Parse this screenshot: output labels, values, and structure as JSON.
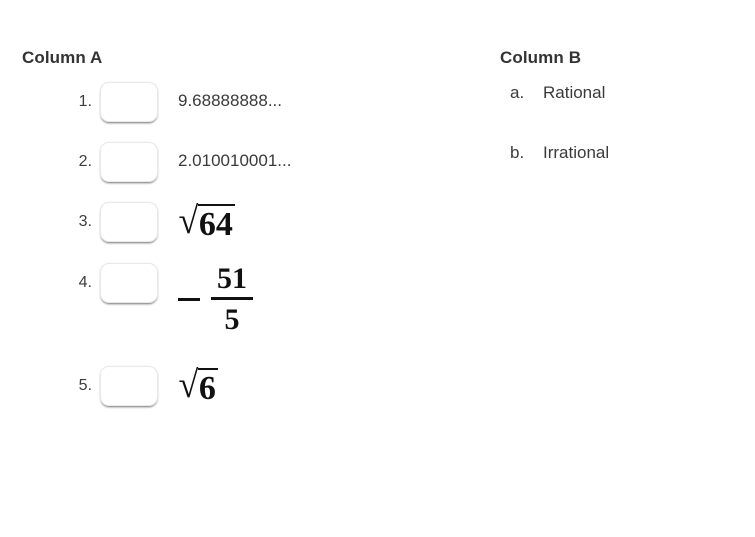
{
  "columns": {
    "a": {
      "heading": "Column A",
      "items": [
        {
          "number": "1.",
          "kind": "decimal",
          "text": "9.68888888..."
        },
        {
          "number": "2.",
          "kind": "decimal",
          "text": "2.010010001..."
        },
        {
          "number": "3.",
          "kind": "radical",
          "radical_sign": "√",
          "radicand": "64"
        },
        {
          "number": "4.",
          "kind": "neg-fraction",
          "sign": "−",
          "numerator": "51",
          "denominator": "5"
        },
        {
          "number": "5.",
          "kind": "radical",
          "radical_sign": "√",
          "radicand": "6"
        }
      ]
    },
    "b": {
      "heading": "Column B",
      "items": [
        {
          "letter": "a.",
          "label": "Rational"
        },
        {
          "letter": "b.",
          "label": "Irrational"
        }
      ]
    }
  },
  "answer_inputs": {
    "value_1": "",
    "value_2": "",
    "value_3": "",
    "value_4": "",
    "value_5": "",
    "placeholder": ""
  },
  "colors": {
    "background": "#ffffff",
    "heading_text": "#333333",
    "body_text": "#3a3a3a",
    "math_text": "#111111",
    "box_border": "#e8e8e8"
  }
}
